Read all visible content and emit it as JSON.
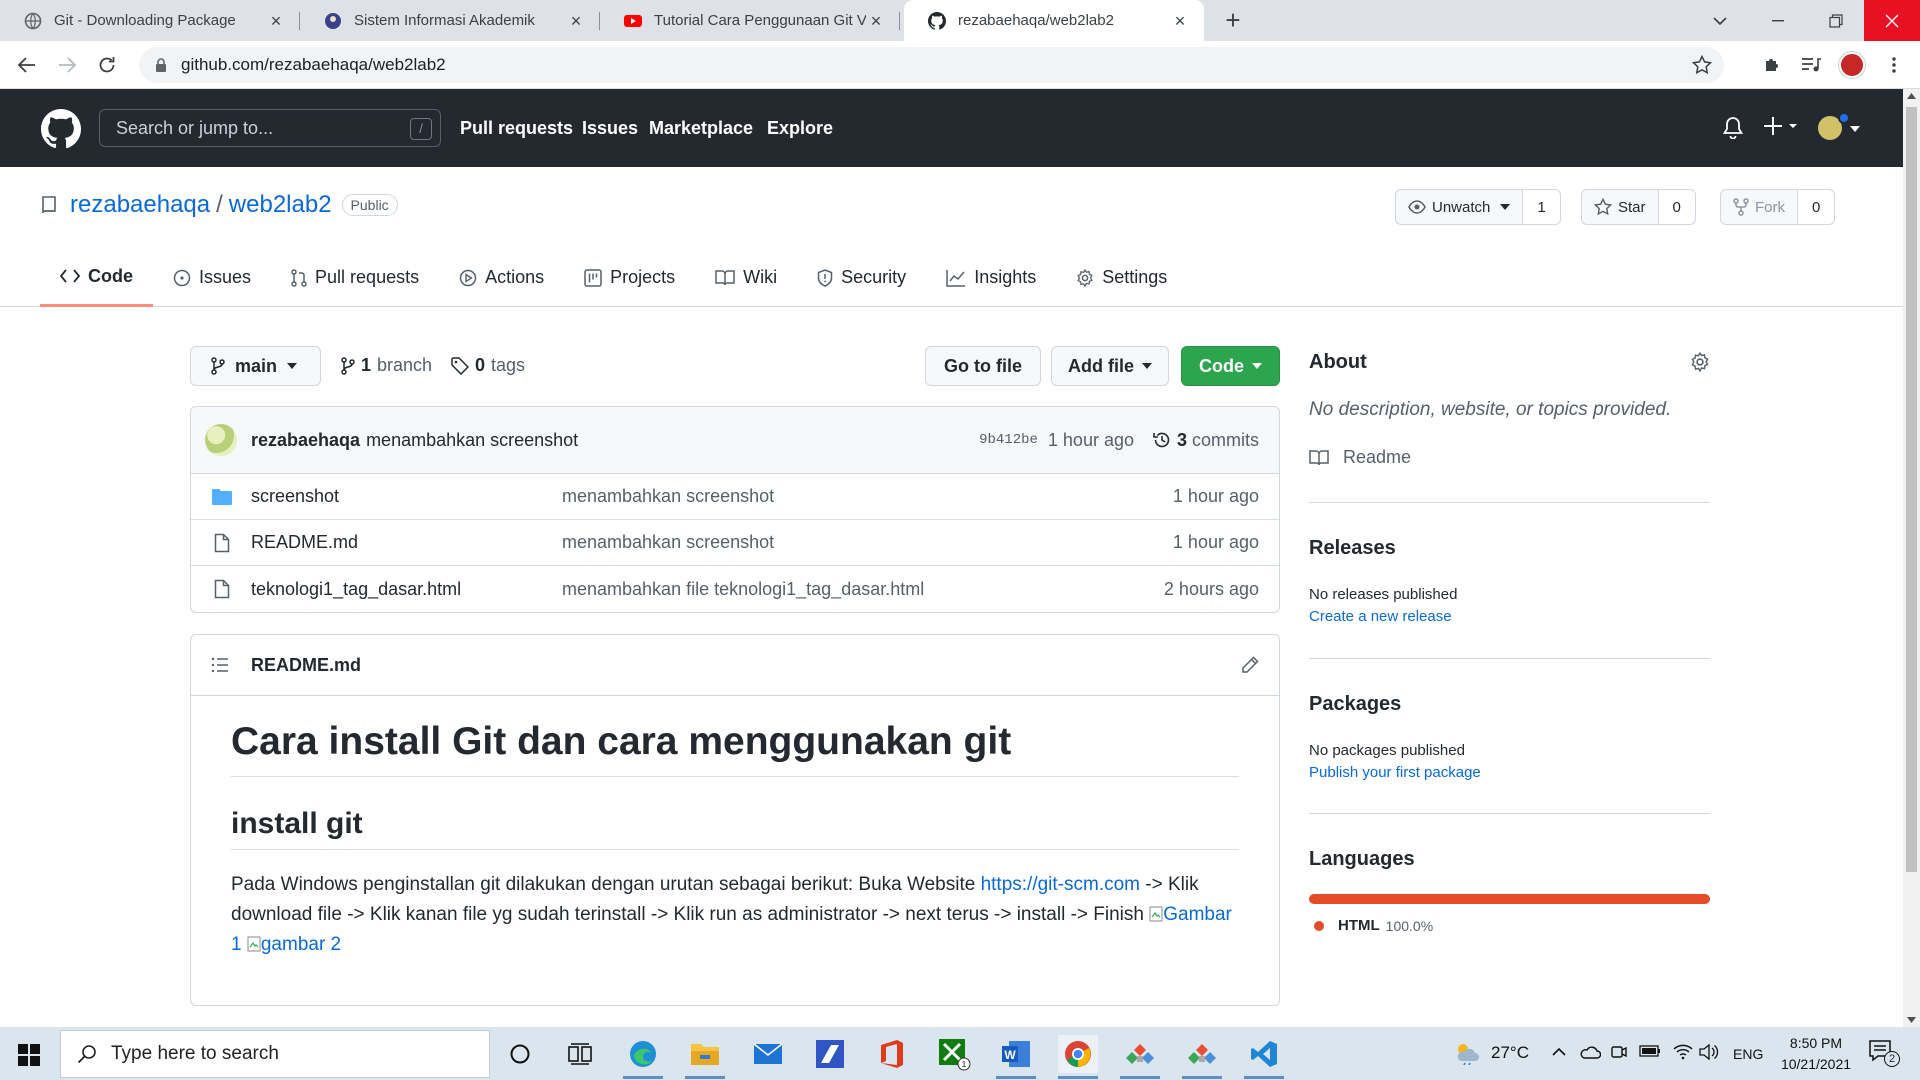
{
  "browser": {
    "tabs": [
      {
        "title": "Git - Downloading Package",
        "active": false
      },
      {
        "title": "Sistem Informasi Akademik",
        "active": false
      },
      {
        "title": "Tutorial Cara Penggunaan Git Ver",
        "active": false
      },
      {
        "title": "rezabaehaqa/web2lab2",
        "active": true
      }
    ],
    "url": "github.com/rezabaehaqa/web2lab2"
  },
  "github_header": {
    "search_placeholder": "Search or jump to...",
    "search_shortcut": "/",
    "nav": [
      "Pull requests",
      "Issues",
      "Marketplace",
      "Explore"
    ]
  },
  "repo": {
    "owner": "rezabaehaqa",
    "separator": "/",
    "name": "web2lab2",
    "visibility": "Public",
    "watch_label": "Unwatch",
    "watch_count": "1",
    "star_label": "Star",
    "star_count": "0",
    "fork_label": "Fork",
    "fork_count": "0",
    "tabs": [
      "Code",
      "Issues",
      "Pull requests",
      "Actions",
      "Projects",
      "Wiki",
      "Security",
      "Insights",
      "Settings"
    ]
  },
  "toolbar": {
    "branch": "main",
    "branch_count": "1",
    "branch_label": "branch",
    "tag_count": "0",
    "tag_label": "tags",
    "go_to_file": "Go to file",
    "add_file": "Add file",
    "code": "Code"
  },
  "latest_commit": {
    "author": "rezabaehaqa",
    "message": "menambahkan screenshot",
    "hash": "9b412be",
    "time": "1 hour ago",
    "commit_count": "3",
    "commit_label": "commits"
  },
  "files": [
    {
      "name": "screenshot",
      "type": "folder",
      "message": "menambahkan screenshot",
      "age": "1 hour ago"
    },
    {
      "name": "README.md",
      "type": "file",
      "message": "menambahkan screenshot",
      "age": "1 hour ago"
    },
    {
      "name": "teknologi1_tag_dasar.html",
      "type": "file",
      "message": "menambahkan file teknologi1_tag_dasar.html",
      "age": "2 hours ago"
    }
  ],
  "readme": {
    "filename": "README.md",
    "h1": "Cara install Git dan cara menggunakan git",
    "h2": "install git",
    "p_before_link": "Pada Windows penginstallan git dilakukan dengan urutan sebagai berikut: Buka Website ",
    "link": "https://git-scm.com",
    "p_after_link": " -> Klik download file -> Klik kanan file yg sudah terinstall -> Klik run as administrator -> next terus -> install -> Finish ",
    "img1_alt": "Gambar 1",
    "img2_alt": "gambar 2"
  },
  "sidebar": {
    "about_title": "About",
    "about_desc": "No description, website, or topics provided.",
    "readme_label": "Readme",
    "releases_title": "Releases",
    "releases_none": "No releases published",
    "releases_link": "Create a new release",
    "packages_title": "Packages",
    "packages_none": "No packages published",
    "packages_link": "Publish your first package",
    "languages_title": "Languages",
    "languages": [
      {
        "name": "HTML",
        "percent": "100.0%",
        "fraction": 1.0,
        "color": "#e34c26"
      }
    ]
  },
  "taskbar": {
    "search_placeholder": "Type here to search",
    "weather": "27°C",
    "lang": "ENG",
    "time": "8:50 PM",
    "date": "10/21/2021",
    "notifications": "2"
  },
  "colors": {
    "accent_blue": "#0969da",
    "code_button_green": "#2da44e",
    "header_bg": "#24292f",
    "tab_underline": "#fd8c73"
  }
}
